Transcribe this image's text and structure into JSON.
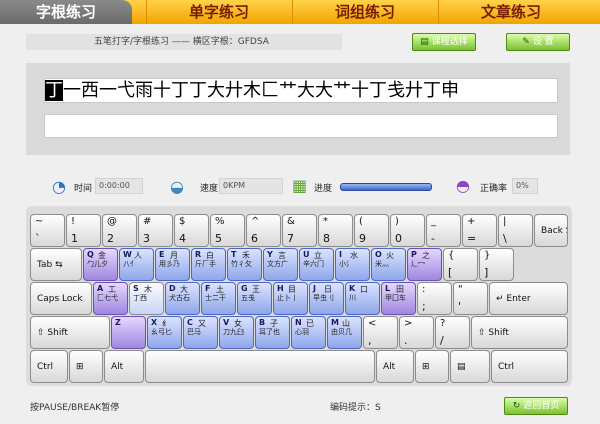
{
  "tabs": [
    {
      "label": "字根练习",
      "active": true
    },
    {
      "label": "单字练习",
      "active": false
    },
    {
      "label": "词组练习",
      "active": false
    },
    {
      "label": "文章练习",
      "active": false
    }
  ],
  "subtitle": "五笔打字/字根练习 —— 横区字根：GFDSA",
  "buttons": {
    "course": "课程选择",
    "settings": "设 置",
    "back": "返回首页"
  },
  "practice": {
    "current_char": "丁",
    "remaining": "一西一弋雨十丁丁大廾木匚艹大大艹十丁戋廾丁申",
    "typed": ""
  },
  "stats": {
    "time_label": "时间",
    "time_value": "0:00:00",
    "speed_label": "速度",
    "speed_value": "0KPM",
    "progress_label": "进度",
    "progress_fraction": 1.0,
    "accuracy_label": "正确率",
    "accuracy_value": "0%"
  },
  "colors": {
    "tab_bar": "#f2a400",
    "accent": "#7cc12f",
    "key_purple": "#9f86e0",
    "key_blue": "#8ea6ea"
  },
  "keyboard": {
    "row1": [
      {
        "top": "~",
        "bottom": "`"
      },
      {
        "top": "!",
        "bottom": "1"
      },
      {
        "top": "@",
        "bottom": "2"
      },
      {
        "top": "#",
        "bottom": "3"
      },
      {
        "top": "$",
        "bottom": "4"
      },
      {
        "top": "%",
        "bottom": "5"
      },
      {
        "top": "^",
        "bottom": "6"
      },
      {
        "top": "&",
        "bottom": "7"
      },
      {
        "top": "*",
        "bottom": "8"
      },
      {
        "top": "(",
        "bottom": "9"
      },
      {
        "top": ")",
        "bottom": "0"
      },
      {
        "top": "_",
        "bottom": "-"
      },
      {
        "top": "+",
        "bottom": "="
      },
      {
        "top": "|",
        "bottom": "\\"
      },
      {
        "label": "Back Space"
      }
    ],
    "row2": [
      {
        "label": "Tab ⇆"
      },
      {
        "letter": "Q",
        "zi": "金",
        "roots": "勹儿夕"
      },
      {
        "letter": "W",
        "zi": "人",
        "roots": "八亻"
      },
      {
        "letter": "E",
        "zi": "月",
        "roots": "用彡乃"
      },
      {
        "letter": "R",
        "zi": "白",
        "roots": "斤厂手"
      },
      {
        "letter": "T",
        "zi": "禾",
        "roots": "竹彳攵"
      },
      {
        "letter": "Y",
        "zi": "言",
        "roots": "文方广"
      },
      {
        "letter": "U",
        "zi": "立",
        "roots": "辛六门"
      },
      {
        "letter": "I",
        "zi": "水",
        "roots": "小氵"
      },
      {
        "letter": "O",
        "zi": "火",
        "roots": "米灬"
      },
      {
        "letter": "P",
        "zi": "之",
        "roots": "辶冖"
      },
      {
        "top": "{",
        "bottom": "["
      },
      {
        "top": "}",
        "bottom": "]"
      }
    ],
    "row3": [
      {
        "label": "Caps Lock"
      },
      {
        "letter": "A",
        "zi": "工",
        "roots": "匚七弋"
      },
      {
        "letter": "S",
        "zi": "木",
        "roots": "丁西"
      },
      {
        "letter": "D",
        "zi": "大",
        "roots": "犬古石"
      },
      {
        "letter": "F",
        "zi": "土",
        "roots": "士二干"
      },
      {
        "letter": "G",
        "zi": "王",
        "roots": "五戋"
      },
      {
        "letter": "H",
        "zi": "目",
        "roots": "止卜丨"
      },
      {
        "letter": "J",
        "zi": "日",
        "roots": "早虫刂"
      },
      {
        "letter": "K",
        "zi": "口",
        "roots": "川"
      },
      {
        "letter": "L",
        "zi": "田",
        "roots": "甲囗车"
      },
      {
        "top": ":",
        "bottom": ";"
      },
      {
        "top": "\"",
        "bottom": "'"
      },
      {
        "label": "↵ Enter"
      }
    ],
    "row4": [
      {
        "label": "⇧ Shift"
      },
      {
        "letter": "Z",
        "zi": "",
        "roots": ""
      },
      {
        "letter": "X",
        "zi": "纟",
        "roots": "幺弓匕"
      },
      {
        "letter": "C",
        "zi": "又",
        "roots": "巴马"
      },
      {
        "letter": "V",
        "zi": "女",
        "roots": "刀九臼"
      },
      {
        "letter": "B",
        "zi": "子",
        "roots": "耳了也"
      },
      {
        "letter": "N",
        "zi": "已",
        "roots": "心羽"
      },
      {
        "letter": "M",
        "zi": "山",
        "roots": "由贝几"
      },
      {
        "top": "<",
        "bottom": ","
      },
      {
        "top": ">",
        "bottom": "."
      },
      {
        "top": "?",
        "bottom": "/"
      },
      {
        "label": "⇧ Shift"
      }
    ],
    "row5": [
      {
        "label": "Ctrl"
      },
      {
        "label": "⊞"
      },
      {
        "label": "Alt"
      },
      {
        "label": ""
      },
      {
        "label": "Alt"
      },
      {
        "label": "⊞"
      },
      {
        "label": "▤"
      },
      {
        "label": "Ctrl"
      }
    ]
  },
  "footer": {
    "pause_hint": "按PAUSE/BREAK暂停",
    "code_hint": "编码提示：S"
  }
}
